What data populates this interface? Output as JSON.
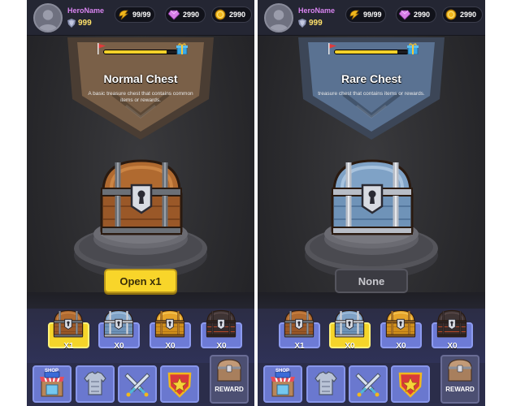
{
  "player": {
    "name": "HeroName",
    "level": "999"
  },
  "currency": {
    "energy": "99/99",
    "gems": "2990",
    "coins": "2990"
  },
  "colors": {
    "common_chest": "#a0602a",
    "rare_chest": "#7fa2c6",
    "gold_chest": "#e0a21e",
    "lava_chest": "#4a3d3d",
    "accent_yellow": "#f8d52a",
    "slot_blue": "#6d7bd6"
  },
  "screens": [
    {
      "chest_name": "Normal Chest",
      "description": "A basic treasure chest that contains common items or rewards.",
      "chest_type": "common",
      "progress": 0.85,
      "action_label": "Open x1",
      "action_state": "enabled",
      "selected_slot": 0
    },
    {
      "chest_name": "Rare Chest",
      "description": "treasure chest that contains items or rewards.",
      "chest_type": "rare",
      "progress": 0.85,
      "action_label": "None",
      "action_state": "disabled",
      "selected_slot": 1
    }
  ],
  "chest_slots": [
    {
      "type": "common",
      "count": "X1"
    },
    {
      "type": "rare",
      "count": "X0"
    },
    {
      "type": "gold",
      "count": "X0"
    },
    {
      "type": "lava",
      "count": "X0"
    }
  ],
  "nav": {
    "shop_sign": "SHOP",
    "reward_label": "REWARD",
    "items": [
      "shop-icon",
      "armor-icon",
      "swords-icon",
      "badge-icon",
      "reward-chest-icon"
    ]
  }
}
